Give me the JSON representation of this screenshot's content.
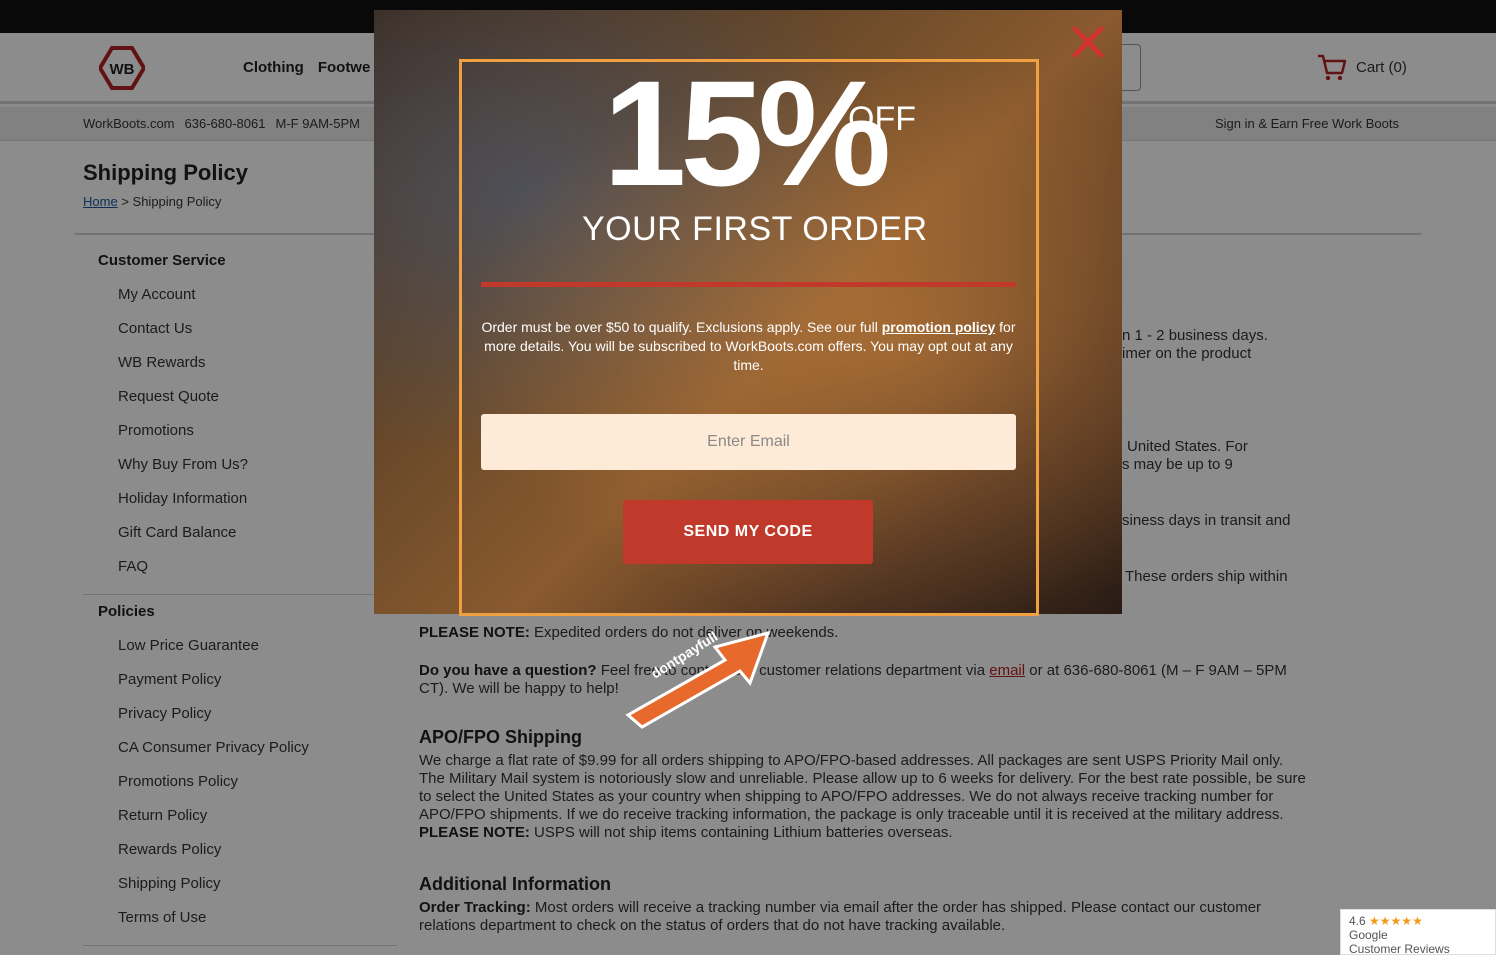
{
  "header": {
    "logo_text": "WB",
    "nav": [
      "Clothing",
      "Footwe"
    ],
    "cart_label": "Cart (0)"
  },
  "infobar": {
    "site": "WorkBoots.com",
    "phone": "636-680-8061",
    "hours": "M-F 9AM-5PM",
    "signin": "Sign in & Earn Free Work Boots"
  },
  "page": {
    "title": "Shipping Policy",
    "breadcrumb_home": "Home",
    "breadcrumb_sep": ">",
    "breadcrumb_current": "Shipping Policy"
  },
  "sidebar": {
    "section1_title": "Customer Service",
    "section1_items": [
      "My Account",
      "Contact Us",
      "WB Rewards",
      "Request Quote",
      "Promotions",
      "Why Buy From Us?",
      "Holiday Information",
      "Gift Card Balance",
      "FAQ"
    ],
    "section2_title": "Policies",
    "section2_items": [
      "Low Price Guarantee",
      "Payment Policy",
      "Privacy Policy",
      "CA Consumer Privacy Policy",
      "Promotions Policy",
      "Return Policy",
      "Rewards Policy",
      "Shipping Policy",
      "Terms of Use"
    ]
  },
  "content": {
    "frag1a": "n 1 - 2 business days.",
    "frag1b": "imer on the product",
    "frag2a": "United States. For",
    "frag2b": "s may be up to 9",
    "frag3": "siness days in transit and",
    "frag4": "These orders ship within",
    "note_label": "PLEASE NOTE:",
    "note_text": " Expedited orders do not deliver on weekends.",
    "question_label": "Do you have a question?",
    "question_text1": " Feel free to contact our customer relations department via ",
    "question_link": "email",
    "question_text2": " or at 636-680-8061 (M – F 9AM – 5PM CT). We will be happy to help!",
    "apo_title": "APO/FPO Shipping",
    "apo_text": "We charge a flat rate of $9.99 for all orders shipping to APO/FPO-based addresses. All packages are sent USPS Priority Mail only. The Military Mail system is notoriously slow and unreliable. Please allow up to 6 weeks for delivery. For the best rate possible, be sure to select the United States as your country when shipping to APO/FPO addresses. We do not always receive tracking number for APO/FPO shipments. If we do receive tracking information, the package is only traceable until it is received at the military address. ",
    "apo_note_label": "PLEASE NOTE:",
    "apo_note_text": " USPS will not ship items containing Lithium batteries overseas.",
    "additional_title": "Additional Information",
    "tracking_label": "Order Tracking:",
    "tracking_text": " Most orders will receive a tracking number via email after the order has shipped. Please contact our customer relations department to check on the status of orders that do not have tracking available."
  },
  "google_badge": {
    "rating": "4.6",
    "stars": "★★★★★",
    "line1": "Google",
    "line2": "Customer Reviews"
  },
  "modal": {
    "percent": "15%",
    "off": "OFF",
    "subtitle": "YOUR FIRST ORDER",
    "disclaimer_before": "Order must be over $50 to qualify. Exclusions apply. See our full ",
    "disclaimer_link": "promotion policy",
    "disclaimer_after": " for more details. You will be subscribed to WorkBoots.com offers. You may opt out at any time.",
    "email_placeholder": "Enter Email",
    "send_label": "SEND MY CODE"
  },
  "watermark": {
    "arrow_text": "dontpayfull"
  },
  "colors": {
    "accent_red": "#c0392b",
    "modal_border": "#f0a040",
    "link_blue": "#1c57a5"
  }
}
